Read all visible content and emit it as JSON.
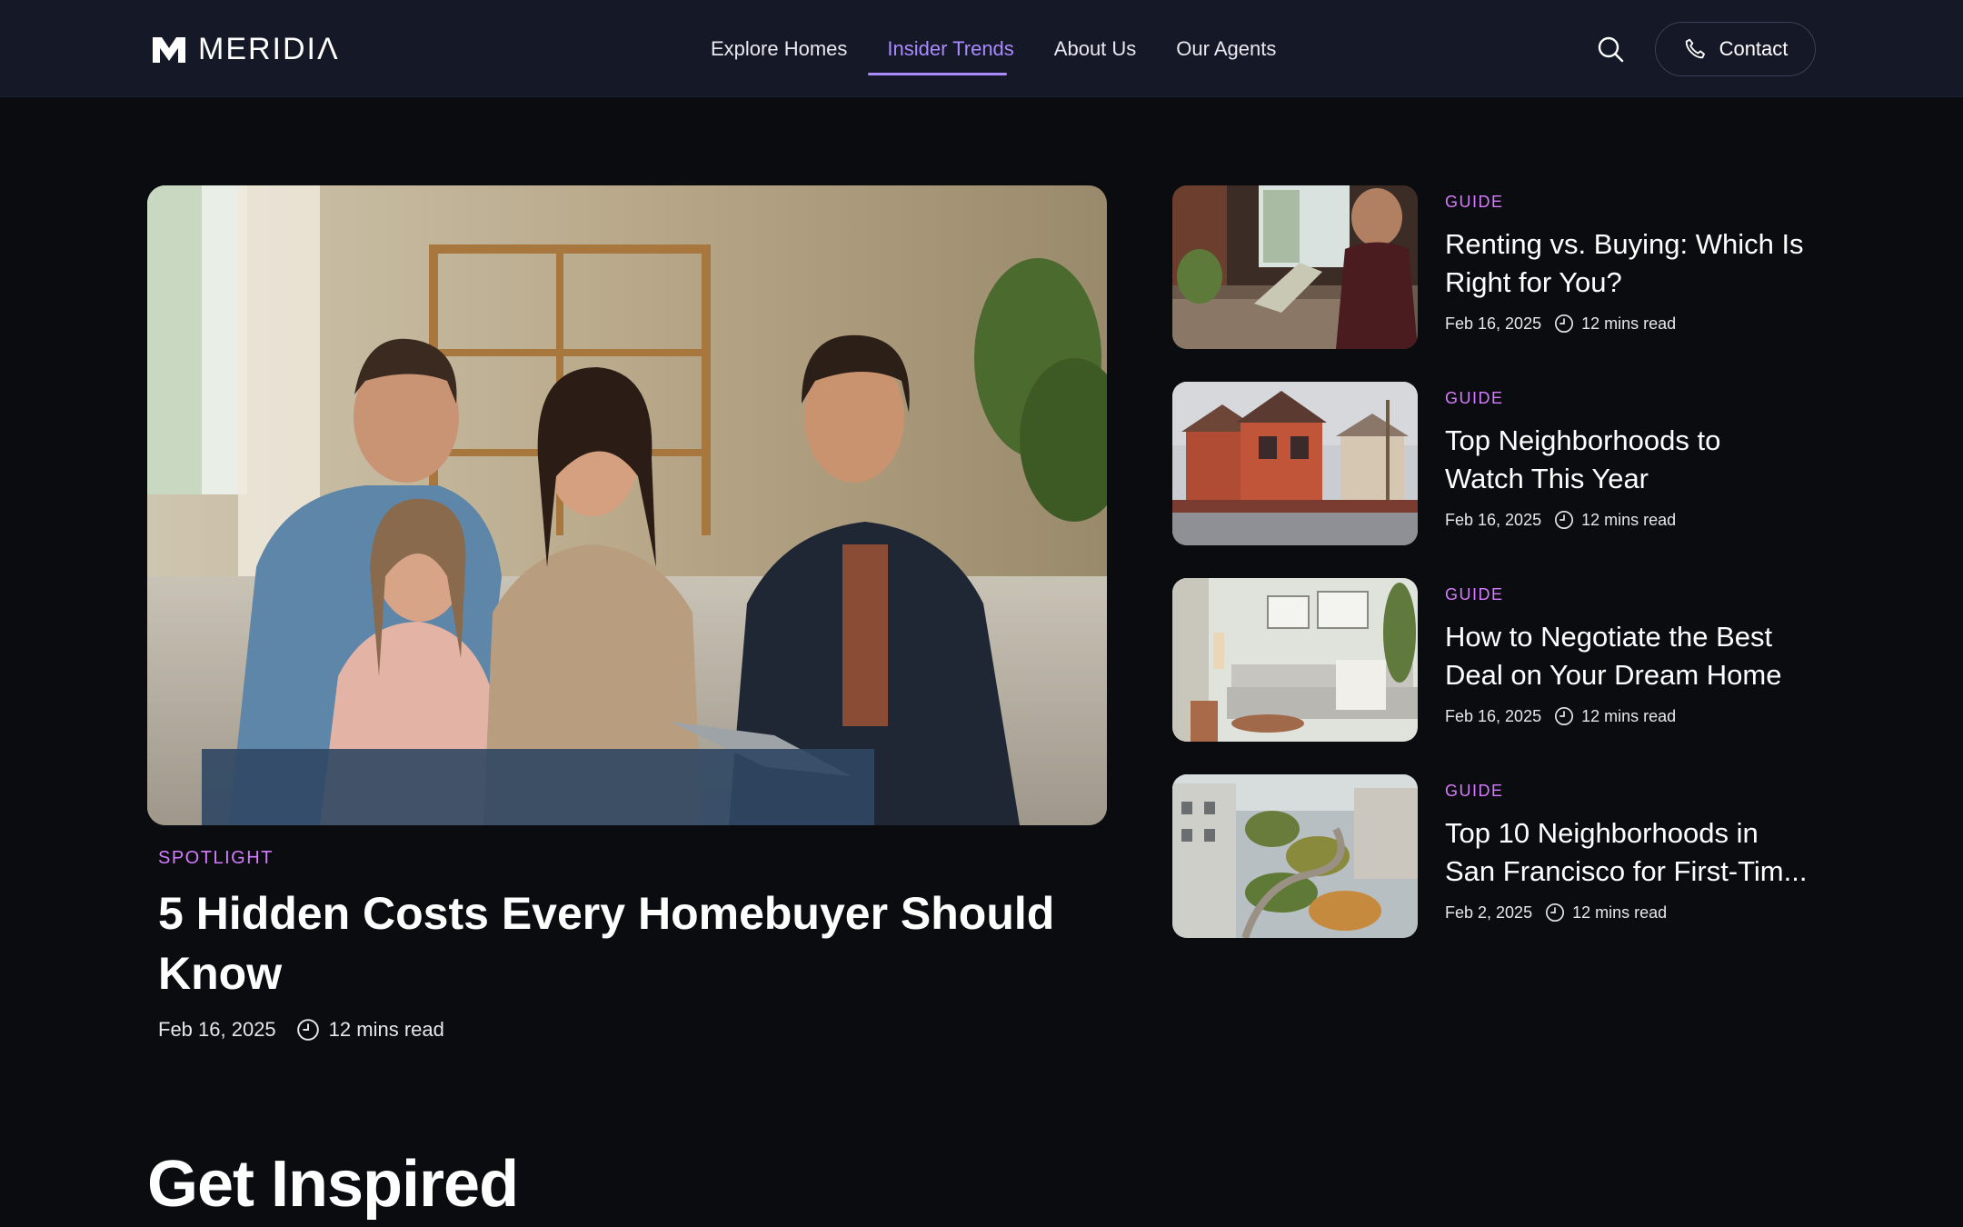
{
  "brand": {
    "name": "MERIDIΛ"
  },
  "nav": {
    "items": [
      {
        "label": "Explore Homes"
      },
      {
        "label": "Insider Trends"
      },
      {
        "label": "About Us"
      },
      {
        "label": "Our Agents"
      }
    ],
    "active": "Insider Trends"
  },
  "header": {
    "contact_label": "Contact"
  },
  "spotlight": {
    "tag": "SPOTLIGHT",
    "title": "5 Hidden Costs Every Homebuyer Should Know",
    "date": "Feb 16, 2025",
    "read_time": "12 mins read"
  },
  "articles": [
    {
      "tag": "GUIDE",
      "title_line1": "Renting vs. Buying: Which Is",
      "title_line2": "Right for You?",
      "date": "Feb 16, 2025",
      "read_time": "12 mins read"
    },
    {
      "tag": "GUIDE",
      "title_line1": "Top Neighborhoods to",
      "title_line2": "Watch This Year",
      "date": "Feb 16, 2025",
      "read_time": "12 mins read"
    },
    {
      "tag": "GUIDE",
      "title_line1": "How to Negotiate the Best",
      "title_line2": "Deal on Your Dream Home",
      "date": "Feb 16, 2025",
      "read_time": "12 mins read"
    },
    {
      "tag": "GUIDE",
      "title_line1": "Top 10 Neighborhoods in",
      "title_line2": "San Francisco for First-Tim...",
      "date": "Feb 2, 2025",
      "read_time": "12 mins read"
    }
  ],
  "section": {
    "heading": "Get Inspired"
  },
  "colors": {
    "accent": "#a98bff",
    "tag": "#d67bff",
    "header_bg": "#151826",
    "page_bg": "#0b0c10"
  }
}
